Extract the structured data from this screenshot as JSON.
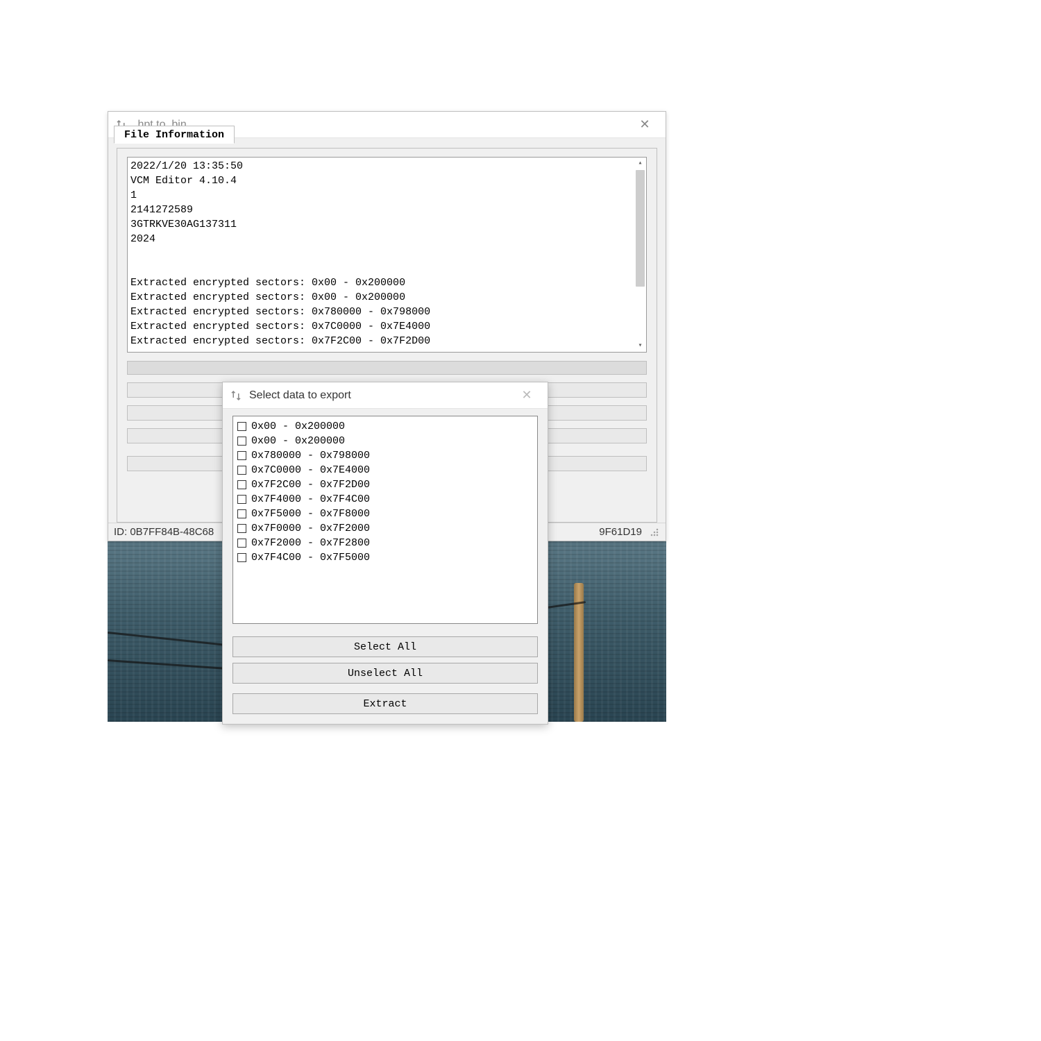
{
  "main_window": {
    "title": ".hpt to .bin",
    "tab_label": "File Information",
    "log_lines": [
      "2022/1/20 13:35:50",
      "VCM Editor 4.10.4",
      "1",
      "2141272589",
      "3GTRKVE30AG137311",
      "2024",
      "",
      "",
      "Extracted encrypted sectors: 0x00 - 0x200000",
      "Extracted encrypted sectors: 0x00 - 0x200000",
      "Extracted encrypted sectors: 0x780000 - 0x798000",
      "Extracted encrypted sectors: 0x7C0000 - 0x7E4000",
      "Extracted encrypted sectors: 0x7F2C00 - 0x7F2D00"
    ],
    "status_left": "ID:  0B7FF84B-48C68",
    "status_right": "9F61D19"
  },
  "modal": {
    "title": "Select data to export",
    "items": [
      "0x00 - 0x200000",
      "0x00 - 0x200000",
      "0x780000 - 0x798000",
      "0x7C0000 - 0x7E4000",
      "0x7F2C00 - 0x7F2D00",
      "0x7F4000 - 0x7F4C00",
      "0x7F5000 - 0x7F8000",
      "0x7F0000 - 0x7F2000",
      "0x7F2000 - 0x7F2800",
      "0x7F4C00 - 0x7F5000"
    ],
    "btn_select_all": "Select All",
    "btn_unselect_all": "Unselect All",
    "btn_extract": "Extract"
  }
}
